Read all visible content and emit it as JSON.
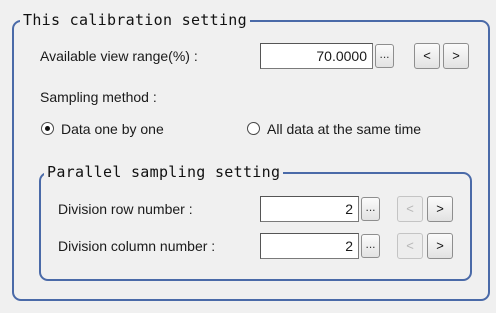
{
  "calibration": {
    "title": "This calibration setting",
    "view_range_label": "Available view range(%) :",
    "view_range_value": "70.0000",
    "ellipsis_label": "...",
    "decrement_label": "<",
    "increment_label": ">",
    "sampling_method_label": "Sampling method :",
    "sampling_options": [
      {
        "label": "Data one by one",
        "selected": true
      },
      {
        "label": "All data at the same time",
        "selected": false
      }
    ]
  },
  "parallel": {
    "title": "Parallel sampling setting",
    "row_label": "Division row number :",
    "row_value": "2",
    "column_label": "Division column number :",
    "column_value": "2",
    "ellipsis_label": "...",
    "decrement_label": "<",
    "increment_label": ">",
    "decrement_disabled": true
  },
  "colors": {
    "group_border": "#4a6aa8",
    "background": "#f0f0f0"
  }
}
